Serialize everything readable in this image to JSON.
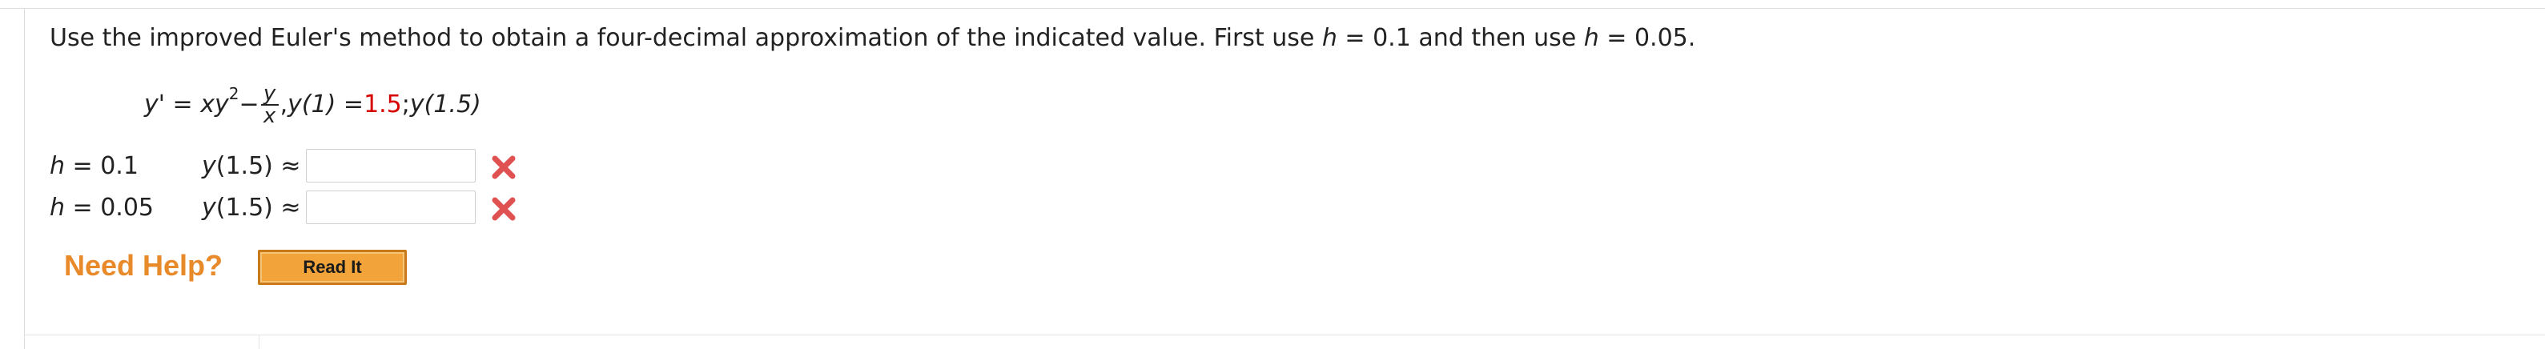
{
  "question": {
    "text_prefix": "Use the improved Euler's method to obtain a four-decimal approximation of the indicated value. First use ",
    "h_var": "h",
    "eq1": " = 0.1 and then use ",
    "eq2": " = 0.05."
  },
  "equation": {
    "lhs": "y' = xy",
    "exp": "2",
    "minus": " − ",
    "frac_num": "y",
    "frac_den": "x",
    "comma": ", ",
    "ic_lhs": "y(1) = ",
    "ic_value": "1.5",
    "sep": ";  ",
    "target": "y(1.5)"
  },
  "rows": [
    {
      "h_label": "h",
      "h_value": " = 0.1",
      "y_label": "y",
      "y_rest": "(1.5) ≈",
      "answer": ""
    },
    {
      "h_label": "h",
      "h_value": " = 0.05",
      "y_label": "y",
      "y_rest": "(1.5) ≈",
      "answer": ""
    }
  ],
  "status_icon": "incorrect-x-icon",
  "colors": {
    "incorrect": "#e05252",
    "accent": "#e8892a",
    "ic_value": "#d60000",
    "button": "#f2a33a"
  },
  "help": {
    "label": "Need Help?",
    "button": "Read It"
  }
}
